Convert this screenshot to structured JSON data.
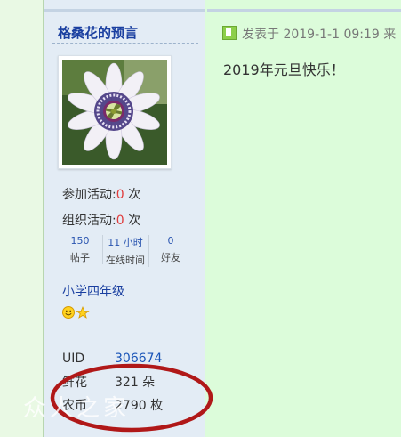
{
  "profile": {
    "username": "格桑花的预言",
    "activities": [
      {
        "label": "参加活动:",
        "value": "0",
        "unit": "次"
      },
      {
        "label": "组织活动:",
        "value": "0",
        "unit": "次"
      }
    ],
    "counts": [
      {
        "value": "150",
        "label": "帖子"
      },
      {
        "value": "11 小时",
        "label": "在线时间"
      },
      {
        "value": "0",
        "label": "好友"
      }
    ],
    "grade": "小学四年级",
    "info": [
      {
        "label": "UID",
        "value": "306674"
      },
      {
        "label": "鲜花",
        "value": "321 朵"
      },
      {
        "label": "农币",
        "value": "2790 枚"
      }
    ]
  },
  "post": {
    "meta": "发表于 2019-1-1 09:19 来",
    "content": "2019年元旦快乐！"
  },
  "watermark": "众人之家",
  "colors": {
    "accent_red": "#b01818",
    "link_blue": "#1a3fa0",
    "count_red": "#e03b3b"
  }
}
